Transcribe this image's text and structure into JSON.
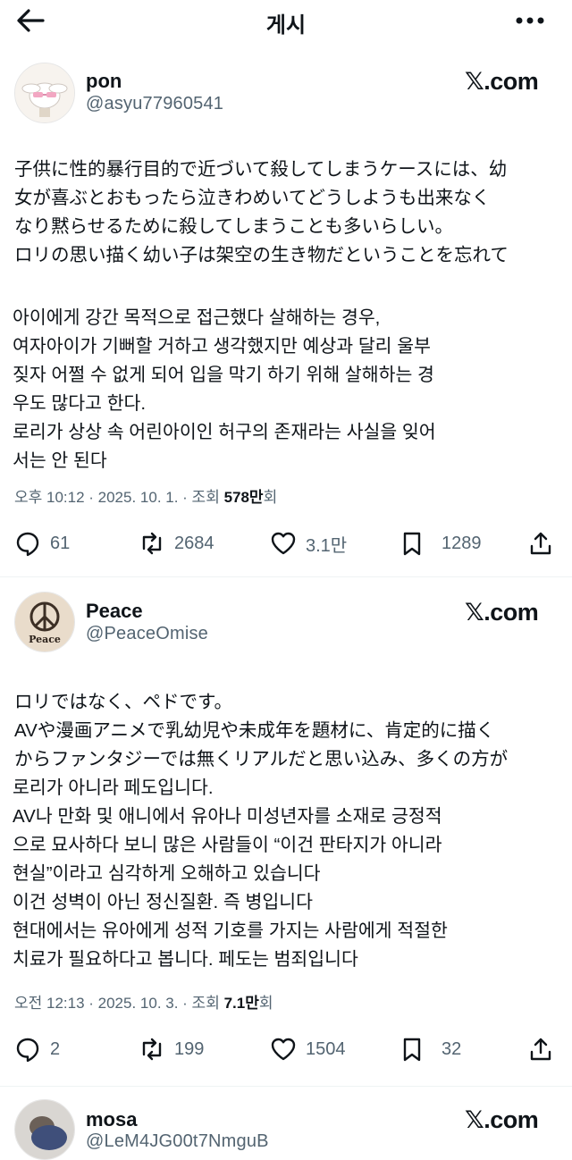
{
  "header": {
    "title": "게시"
  },
  "posts": [
    {
      "name": "pon",
      "handle": "@asyu77960541",
      "source": "𝕏.com",
      "jp_lines": [
        "子供に性的暴行目的で近づいて殺してしまうケースには、幼",
        "女が喜ぶとおもったら泣きわめいてどうしようも出来なく",
        "なり黙らせるために殺してしまうことも多いらしい。",
        "ロリの思い描く幼い子は架空の生き物だということを忘れて"
      ],
      "ko_lines": [
        "아이에게 강간 목적으로 접근했다 살해하는 경우,",
        "여자아이가 기뻐할 거하고 생각했지만 예상과 달리 울부",
        "짖자 어쩔 수 없게 되어 입을 막기 하기 위해 살해하는 경",
        "우도 많다고 한다.",
        "로리가 상상 속 어린아이인 허구의 존재라는 사실을 잊어",
        "서는 안 된다"
      ],
      "time": "오후 10:12 · 2025. 10. 1. · 조회 ",
      "views": "578만",
      "views_suffix": "회",
      "replies": "61",
      "reposts": "2684",
      "likes": "3.1만",
      "bookmarks": "1289"
    },
    {
      "name": "Peace",
      "handle": "@PeaceOmise",
      "source": "𝕏.com",
      "avatar_text": "Peace",
      "jp_lines": [
        "ロリではなく、ペドです。",
        "AVや漫画アニメで乳幼児や未成年を題材に、肯定的に描く",
        "からファンタジーでは無くリアルだと思い込み、多くの方が"
      ],
      "ko_lines": [
        "로리가 아니라 페도입니다.",
        "AV나 만화 및 애니에서 유아나 미성년자를 소재로 긍정적",
        "으로 묘사하다 보니 많은 사람들이 “이건 판타지가 아니라",
        "현실”이라고 심각하게 오해하고 있습니다",
        "이건 성벽이 아닌 정신질환. 즉 병입니다",
        "현대에서는 유아에게 성적 기호를 가지는 사람에게 적절한",
        "치료가 필요하다고 봅니다. 페도는 범죄입니다"
      ],
      "time": "오전 12:13 · 2025. 10. 3. · 조회 ",
      "views": "7.1만",
      "views_suffix": "회",
      "replies": "2",
      "reposts": "199",
      "likes": "1504",
      "bookmarks": "32"
    },
    {
      "name": "mosa",
      "handle": "@LeM4JG00t7NmguB",
      "source": "𝕏.com"
    }
  ],
  "colors": {
    "text": "#0f1419",
    "muted": "#536471",
    "divider": "#eff3f4"
  },
  "icons": [
    "back-arrow-icon",
    "more-icon",
    "reply-icon",
    "repost-icon",
    "like-icon",
    "bookmark-icon",
    "share-icon"
  ]
}
